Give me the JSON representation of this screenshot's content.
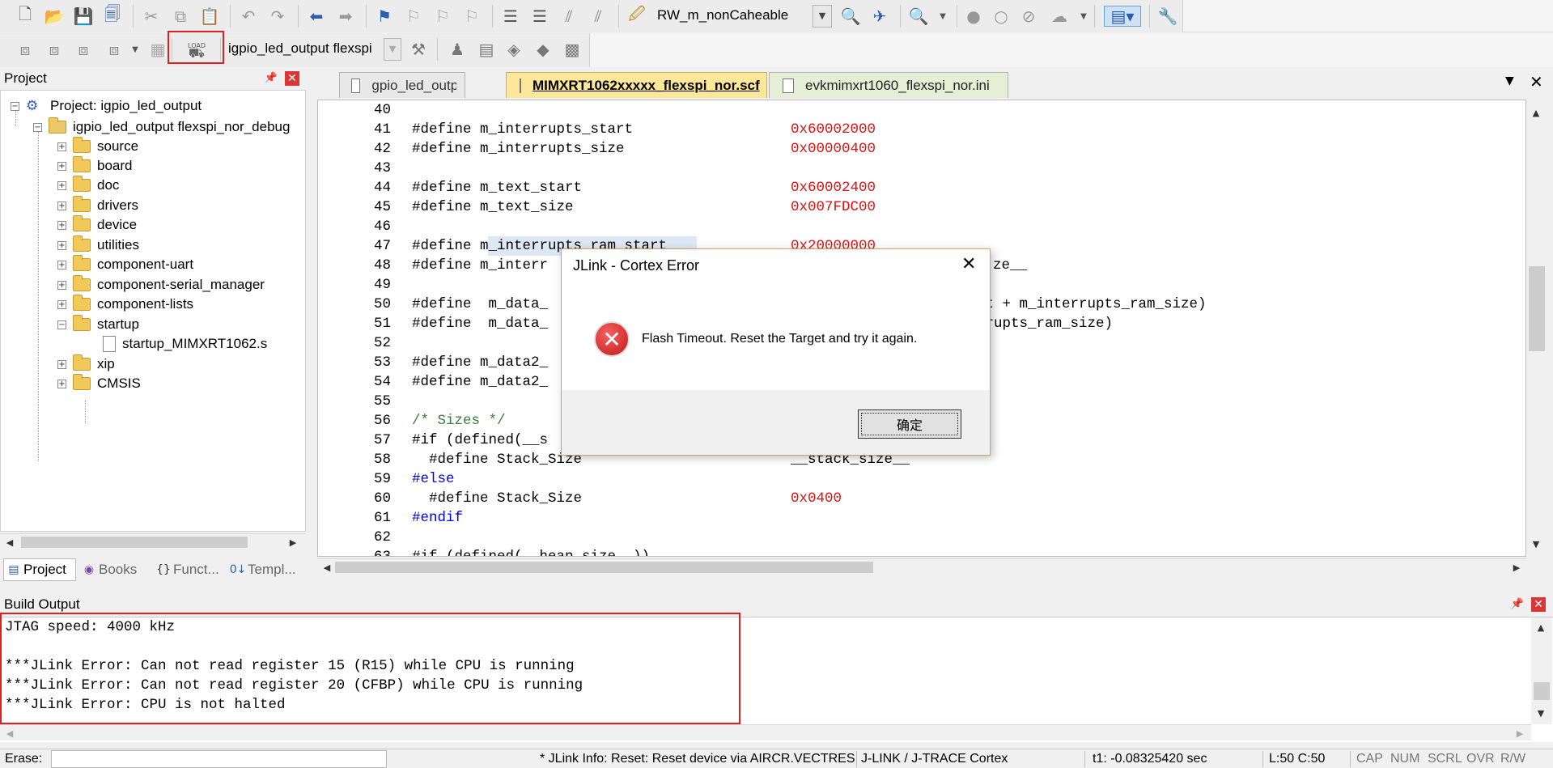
{
  "toolbar1": {
    "target_combo": "RW_m_nonCaheable"
  },
  "toolbar2": {
    "load_label": "LOAD",
    "target_select": "igpio_led_output flexspi"
  },
  "project_panel": {
    "title": "Project",
    "root": "Project: igpio_led_output",
    "target": "igpio_led_output flexspi_nor_debug",
    "groups": [
      "source",
      "board",
      "doc",
      "drivers",
      "device",
      "utilities",
      "component-uart",
      "component-serial_manager",
      "component-lists",
      "startup"
    ],
    "startup_file": "startup_MIMXRT1062.s",
    "groups_after": [
      "xip",
      "CMSIS"
    ],
    "bottom_tabs": [
      "Project",
      "Books",
      "Funct...",
      "Templ..."
    ]
  },
  "editor": {
    "tabs": [
      "gpio_led_output.c",
      "MIMXRT1062xxxxx_flexspi_nor.scf",
      "evkmimxrt1060_flexspi_nor.ini"
    ],
    "active_tab_index": 1,
    "lines": [
      {
        "n": "40",
        "code": "",
        "val": ""
      },
      {
        "n": "41",
        "code": "#define m_interrupts_start",
        "val": "0x60002000"
      },
      {
        "n": "42",
        "code": "#define m_interrupts_size",
        "val": "0x00000400"
      },
      {
        "n": "43",
        "code": "",
        "val": ""
      },
      {
        "n": "44",
        "code": "#define m_text_start",
        "val": "0x60002400"
      },
      {
        "n": "45",
        "code": "#define m_text_size",
        "val": "0x007FDC00"
      },
      {
        "n": "46",
        "code": "",
        "val": ""
      },
      {
        "n": "47",
        "code": "#define m_interrupts_ram_start",
        "val": "0x20000000"
      },
      {
        "n": "48",
        "code": "#define m_interr",
        "val": "",
        "tail": "ze__"
      },
      {
        "n": "49",
        "code": "",
        "val": ""
      },
      {
        "n": "50",
        "code": "#define  m_data_",
        "val": "",
        "tail": "rt + m_interrupts_ram_size)"
      },
      {
        "n": "51",
        "code": "#define  m_data_",
        "val": "",
        "tail": "rrupts_ram_size)"
      },
      {
        "n": "52",
        "code": "",
        "val": ""
      },
      {
        "n": "53",
        "code": "#define m_data2_",
        "val": ""
      },
      {
        "n": "54",
        "code": "#define m_data2_",
        "val": ""
      },
      {
        "n": "55",
        "code": "",
        "val": ""
      },
      {
        "n": "56",
        "code": "/* Sizes */",
        "val": ""
      },
      {
        "n": "57",
        "code": "#if (defined(__s",
        "val": ""
      },
      {
        "n": "58",
        "code": "  #define Stack_Size",
        "val": "",
        "tail": "__stack_size__"
      },
      {
        "n": "59",
        "code": "#else",
        "val": ""
      },
      {
        "n": "60",
        "code": "  #define Stack_Size",
        "val": "0x0400"
      },
      {
        "n": "61",
        "code": "#endif",
        "val": ""
      },
      {
        "n": "62",
        "code": "",
        "val": ""
      },
      {
        "n": "63",
        "code": "#if (defined(__heap_size__))",
        "val": ""
      }
    ]
  },
  "dialog": {
    "title": "JLink - Cortex Error",
    "message": "Flash Timeout. Reset the Target and try it again.",
    "ok": "确定"
  },
  "build_output": {
    "title": "Build Output",
    "lines": [
      "JTAG speed: 4000 kHz",
      "",
      "***JLink Error: Can not read register 15 (R15) while CPU is running",
      "***JLink Error: Can not read register 20 (CFBP) while CPU is running",
      "***JLink Error: CPU is not halted"
    ]
  },
  "statusbar": {
    "erase_label": "Erase:",
    "info": "* JLink Info: Reset: Reset device via AIRCR.VECTRES",
    "debugger": "J-LINK / J-TRACE Cortex",
    "time": "t1: -0.08325420 sec",
    "position": "L:50 C:50",
    "indicators": [
      "CAP",
      "NUM",
      "SCRL",
      "OVR",
      "R/W"
    ]
  },
  "colors": {
    "keyword": "#0000d8",
    "number": "#e01010",
    "highlight_box": "#e02020",
    "active_tab": "#fde89a"
  }
}
